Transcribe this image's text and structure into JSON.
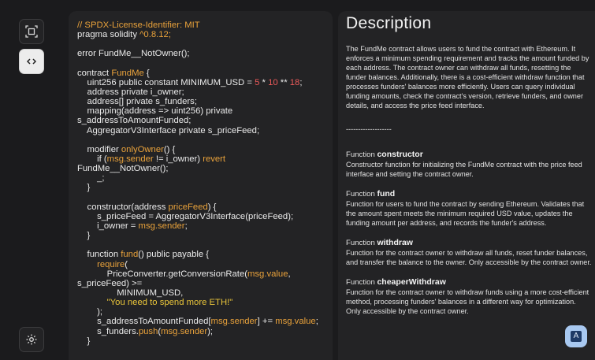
{
  "sidebar": {
    "buttons": [
      {
        "icon": "scan-icon"
      },
      {
        "icon": "code-icon"
      },
      {
        "icon": "settings-icon"
      }
    ]
  },
  "code": {
    "lines": [
      [
        {
          "t": "// SPDX-License-Identifier: MIT",
          "c": "c"
        }
      ],
      [
        {
          "t": "pragma solidity ",
          "c": ""
        },
        {
          "t": "^0.8.12;",
          "c": "c"
        }
      ],
      [],
      [
        {
          "t": "error FundMe__NotOwner();",
          "c": ""
        }
      ],
      [],
      [
        {
          "t": "contract ",
          "c": ""
        },
        {
          "t": "FundMe",
          "c": "c"
        },
        {
          "t": " {",
          "c": ""
        }
      ],
      [
        {
          "t": "    uint256 public constant MINIMUM_USD = ",
          "c": ""
        },
        {
          "t": "5",
          "c": "num"
        },
        {
          "t": " * ",
          "c": ""
        },
        {
          "t": "10",
          "c": "num"
        },
        {
          "t": " ** ",
          "c": ""
        },
        {
          "t": "18",
          "c": "num"
        },
        {
          "t": ";",
          "c": ""
        }
      ],
      [
        {
          "t": "    address private i_owner;",
          "c": ""
        }
      ],
      [
        {
          "t": "    address[] private s_funders;",
          "c": ""
        }
      ],
      [
        {
          "t": "    mapping(address => uint256) private",
          "c": ""
        }
      ],
      [
        {
          "t": "s_addressToAmountFunded;",
          "c": ""
        }
      ],
      [
        {
          "t": "    AggregatorV3Interface private s_priceFeed;",
          "c": ""
        }
      ],
      [],
      [
        {
          "t": "    modifier ",
          "c": ""
        },
        {
          "t": "onlyOwner",
          "c": "c"
        },
        {
          "t": "() {",
          "c": ""
        }
      ],
      [
        {
          "t": "        if (",
          "c": ""
        },
        {
          "t": "msg.sender",
          "c": "c"
        },
        {
          "t": " != i_owner) ",
          "c": ""
        },
        {
          "t": "revert",
          "c": "c"
        }
      ],
      [
        {
          "t": "FundMe__NotOwner();",
          "c": ""
        }
      ],
      [
        {
          "t": "        _;",
          "c": ""
        }
      ],
      [
        {
          "t": "    }",
          "c": ""
        }
      ],
      [],
      [
        {
          "t": "    constructor(address ",
          "c": ""
        },
        {
          "t": "priceFeed",
          "c": "c"
        },
        {
          "t": ") {",
          "c": ""
        }
      ],
      [
        {
          "t": "        s_priceFeed = AggregatorV3Interface(priceFeed);",
          "c": ""
        }
      ],
      [
        {
          "t": "        i_owner = ",
          "c": ""
        },
        {
          "t": "msg.sender",
          "c": "c"
        },
        {
          "t": ";",
          "c": ""
        }
      ],
      [
        {
          "t": "    }",
          "c": ""
        }
      ],
      [],
      [
        {
          "t": "    function ",
          "c": ""
        },
        {
          "t": "fund",
          "c": "c"
        },
        {
          "t": "() public payable {",
          "c": ""
        }
      ],
      [
        {
          "t": "        ",
          "c": ""
        },
        {
          "t": "require",
          "c": "c"
        },
        {
          "t": "(",
          "c": ""
        }
      ],
      [
        {
          "t": "            PriceConverter.getConversionRate(",
          "c": ""
        },
        {
          "t": "msg.value",
          "c": "c"
        },
        {
          "t": ",",
          "c": ""
        }
      ],
      [
        {
          "t": "s_priceFeed) >=",
          "c": ""
        }
      ],
      [
        {
          "t": "                MINIMUM_USD,",
          "c": ""
        }
      ],
      [
        {
          "t": "            ",
          "c": ""
        },
        {
          "t": "\"You need to spend more ETH!\"",
          "c": "str"
        }
      ],
      [
        {
          "t": "        );",
          "c": ""
        }
      ],
      [
        {
          "t": "        s_addressToAmountFunded[",
          "c": ""
        },
        {
          "t": "msg.sender",
          "c": "c"
        },
        {
          "t": "] += ",
          "c": ""
        },
        {
          "t": "msg.value",
          "c": "c"
        },
        {
          "t": ";",
          "c": ""
        }
      ],
      [
        {
          "t": "        s_funders.",
          "c": ""
        },
        {
          "t": "push",
          "c": "c"
        },
        {
          "t": "(",
          "c": ""
        },
        {
          "t": "msg.sender",
          "c": "c"
        },
        {
          "t": ");",
          "c": ""
        }
      ],
      [
        {
          "t": "    }",
          "c": ""
        }
      ]
    ]
  },
  "description": {
    "title": "Description",
    "intro": "The FundMe contract allows users to fund the contract with Ethereum. It enforces a minimum spending requirement and tracks the amount funded by each address. The contract owner can withdraw all funds, resetting the funder balances. Additionally, there is a cost-efficient withdraw function that processes funders' balances more efficiently. Users can query individual funding amounts, check the contract's version, retrieve funders, and owner details, and access the price feed interface.",
    "separator": "-------------------",
    "functions": [
      {
        "prefix": "Function ",
        "name": "constructor",
        "text": "Constructor function for initializing the FundMe contract with the price feed interface and setting the contract owner."
      },
      {
        "prefix": "Function ",
        "name": "fund",
        "text": "Function for users to fund the contract by sending Ethereum. Validates that the amount spent meets the minimum required USD value, updates the funding amount per address, and records the funder's address."
      },
      {
        "prefix": "Function ",
        "name": "withdraw",
        "text": "Function for the contract owner to withdraw all funds, reset funder balances, and transfer the balance to the owner. Only accessible by the contract owner."
      },
      {
        "prefix": "Function ",
        "name": "cheaperWithdraw",
        "text": "Function for the contract owner to withdraw funds using a more cost-efficient method, processing funders' balances in a different way for optimization. Only accessible by the contract owner."
      }
    ]
  },
  "assistant_button": {
    "label": "A"
  }
}
